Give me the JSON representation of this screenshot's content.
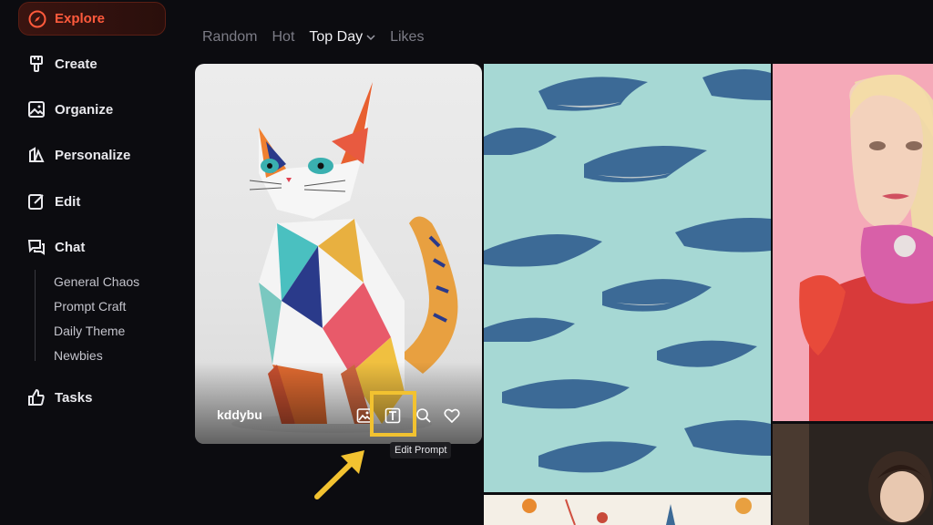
{
  "sidebar": {
    "explore_label": "Explore",
    "items": [
      {
        "label": "Create",
        "icon": "brush-icon"
      },
      {
        "label": "Organize",
        "icon": "image-icon"
      },
      {
        "label": "Personalize",
        "icon": "personalize-icon"
      },
      {
        "label": "Edit",
        "icon": "edit-icon"
      },
      {
        "label": "Chat",
        "icon": "chat-icon"
      }
    ],
    "chat_channels": [
      "General Chaos",
      "Prompt Craft",
      "Daily Theme",
      "Newbies"
    ],
    "tasks_label": "Tasks"
  },
  "sort_tabs": {
    "random": "Random",
    "hot": "Hot",
    "top_day": "Top Day",
    "likes": "Likes"
  },
  "feed": {
    "featured_card": {
      "username": "kddybu",
      "tooltip": "Edit Prompt"
    }
  },
  "colors": {
    "accent": "#ff5a3c",
    "highlight": "#f2c230",
    "background": "#0c0c10"
  }
}
